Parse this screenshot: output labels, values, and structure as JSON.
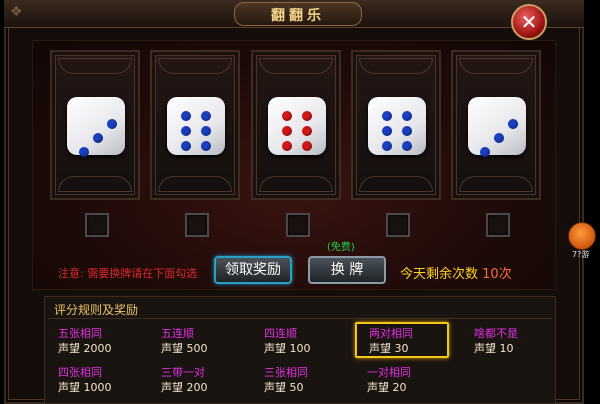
{
  "window": {
    "title": "翻翻乐"
  },
  "icons": {
    "close": "close-icon",
    "side": "mascot-icon"
  },
  "dice": [
    {
      "value": 3,
      "color": "#1a3fc0"
    },
    {
      "value": 6,
      "color": "#1a3fc0"
    },
    {
      "value": 6,
      "color": "#d01818"
    },
    {
      "value": 6,
      "color": "#1a3fc0"
    },
    {
      "value": 3,
      "color": "#1a3fc0"
    }
  ],
  "notice": "注意: 需要换牌请在下面勾选",
  "buttons": {
    "claim": "领取奖励",
    "change": "换 牌",
    "free": "(免费)"
  },
  "remaining": {
    "label": "今天剩余次数",
    "count": "10次"
  },
  "side": {
    "label": "7?游"
  },
  "rules": {
    "title": "评分规则及奖励",
    "items": [
      {
        "name": "五张相同",
        "reward": "声望 2000",
        "highlighted": false
      },
      {
        "name": "五连顺",
        "reward": "声望 500",
        "highlighted": false
      },
      {
        "name": "四连顺",
        "reward": "声望 100",
        "highlighted": false
      },
      {
        "name": "两对相同",
        "reward": "声望 30",
        "highlighted": true
      },
      {
        "name": "啥都不是",
        "reward": "声望 10",
        "highlighted": false
      },
      {
        "name": "四张相同",
        "reward": "声望 1000",
        "highlighted": false
      },
      {
        "name": "三带一对",
        "reward": "声望 200",
        "highlighted": false
      },
      {
        "name": "三张相同",
        "reward": "声望 50",
        "highlighted": false
      },
      {
        "name": "一对相同",
        "reward": "声望 20",
        "highlighted": false
      }
    ]
  },
  "colors": {
    "title": "#f3d48a",
    "rule_name": "#e030e0",
    "notice": "#e0282a",
    "remaining": "#ffd21e",
    "highlight": "#f4c81a"
  }
}
